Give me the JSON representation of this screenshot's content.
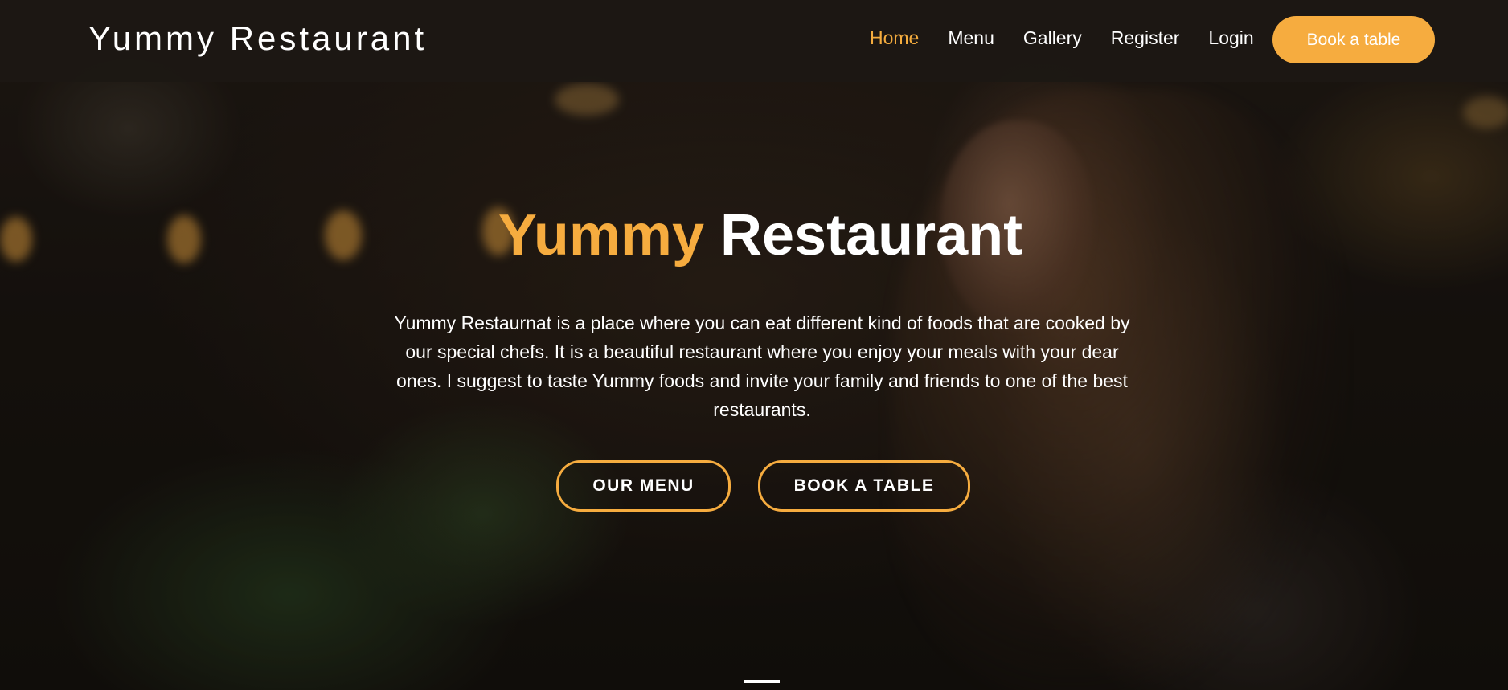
{
  "header": {
    "logo": "Yummy Restaurant",
    "nav": [
      {
        "label": "Home",
        "active": true
      },
      {
        "label": "Menu",
        "active": false
      },
      {
        "label": "Gallery",
        "active": false
      },
      {
        "label": "Register",
        "active": false
      },
      {
        "label": "Login",
        "active": false
      }
    ],
    "cta_label": "Book a table"
  },
  "hero": {
    "title_accent": "Yummy",
    "title_rest": "Restaurant",
    "description": "Yummy Restaurnat is a place where you can eat different kind of foods that are cooked by our special chefs. It is a beautiful restaurant where you enjoy your meals with your dear ones. I suggest to taste Yummy foods and invite your family and friends to one of the best restaurants.",
    "btn_menu": "OUR MENU",
    "btn_table": "BOOK A TABLE"
  },
  "colors": {
    "accent": "#f6ac3f",
    "header_bg": "#1c1814",
    "text": "#ffffff"
  }
}
